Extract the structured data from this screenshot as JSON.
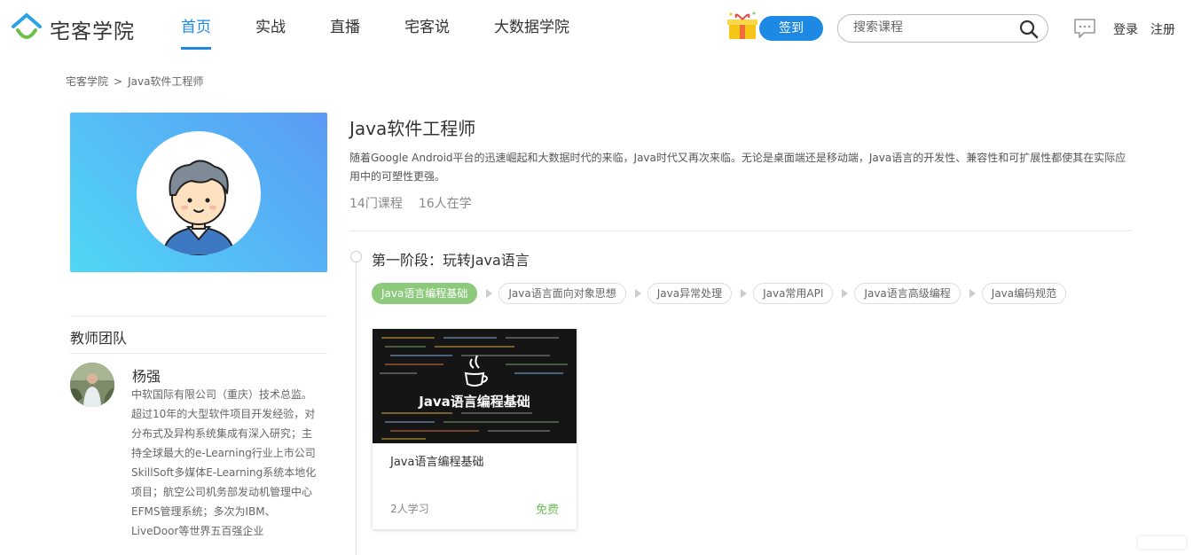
{
  "header": {
    "logo_text": "宅客学院",
    "nav": [
      "首页",
      "实战",
      "直播",
      "宅客说",
      "大数据学院"
    ],
    "signin_label": "签到",
    "search_placeholder": "搜索课程",
    "login_label": "登录",
    "register_label": "注册",
    "accent": "#1e88e5"
  },
  "breadcrumb": {
    "home": "宅客学院",
    "sep": ">",
    "current": "Java软件工程师"
  },
  "course": {
    "title": "Java软件工程师",
    "description": "随着Google Android平台的迅速崛起和大数据时代的来临，Java时代又再次来临。无论是桌面端还是移动端，Java语言的开发性、兼容性和可扩展性都使其在实际应用中的可塑性更强。",
    "lesson_count": "14门课程",
    "learner_count": "16人在学"
  },
  "team": {
    "title": "教师团队",
    "teacher_name": "杨强",
    "teacher_desc": "中软国际有限公司（重庆）技术总监。超过10年的大型软件项目开发经验，对分布式及异构系统集成有深入研究；主持全球最大的e-Learning行业上市公司SkillSoft多媒体E-Learning系统本地化项目；航空公司机务部发动机管理中心EFMS管理系统；多次为IBM、LiveDoor等世界五百强企业"
  },
  "stage": {
    "title": "第一阶段：玩转Java语言",
    "tags": [
      "Java语言编程基础",
      "Java语言面向对象思想",
      "Java异常处理",
      "Java常用API",
      "Java语言高级编程",
      "Java编码规范"
    ]
  },
  "card": {
    "image_title": "Java语言编程基础",
    "name": "Java语言编程基础",
    "count": "2人学习",
    "price": "免费",
    "price_color": "#6cbf5a"
  }
}
